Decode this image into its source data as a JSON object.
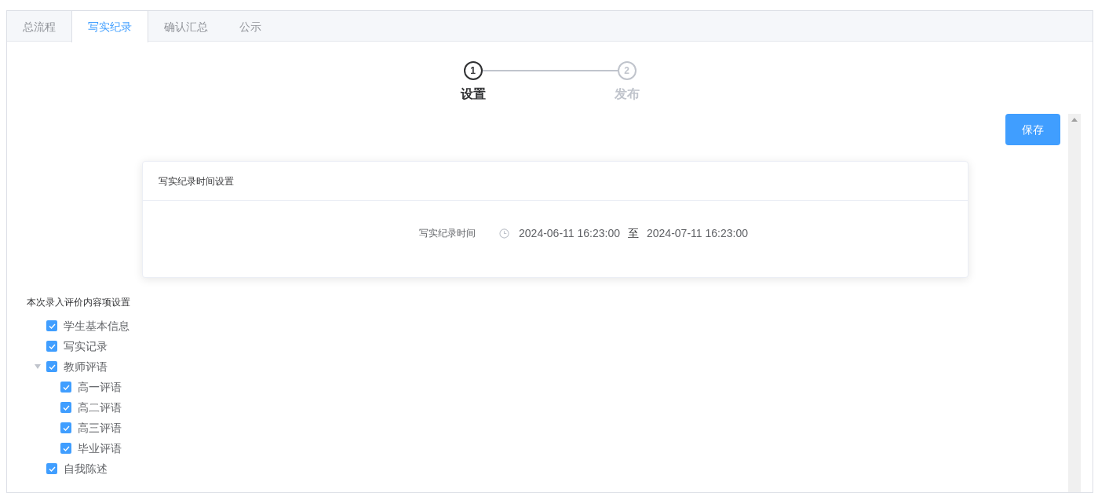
{
  "tabs": [
    {
      "label": "总流程",
      "selected": false
    },
    {
      "label": "写实纪录",
      "selected": true
    },
    {
      "label": "确认汇总",
      "selected": false
    },
    {
      "label": "公示",
      "selected": false
    }
  ],
  "steps": [
    {
      "number": "1",
      "label": "设置",
      "selected": true
    },
    {
      "number": "2",
      "label": "发布",
      "selected": false
    }
  ],
  "save_button": "保存",
  "time_card": {
    "title": "写实纪录时间设置",
    "field_label": "写实纪录时间",
    "start": "2024-06-11 16:23:00",
    "separator": "至",
    "end": "2024-07-11 16:23:00"
  },
  "content_settings": {
    "title": "本次录入评价内容项设置",
    "items": [
      {
        "label": "学生基本信息",
        "checked": true
      },
      {
        "label": "写实记录",
        "checked": true
      },
      {
        "label": "教师评语",
        "checked": true,
        "expanded": true,
        "children": [
          {
            "label": "高一评语",
            "checked": true
          },
          {
            "label": "高二评语",
            "checked": true
          },
          {
            "label": "高三评语",
            "checked": true
          },
          {
            "label": "毕业评语",
            "checked": true
          }
        ]
      },
      {
        "label": "自我陈述",
        "checked": true
      }
    ]
  }
}
